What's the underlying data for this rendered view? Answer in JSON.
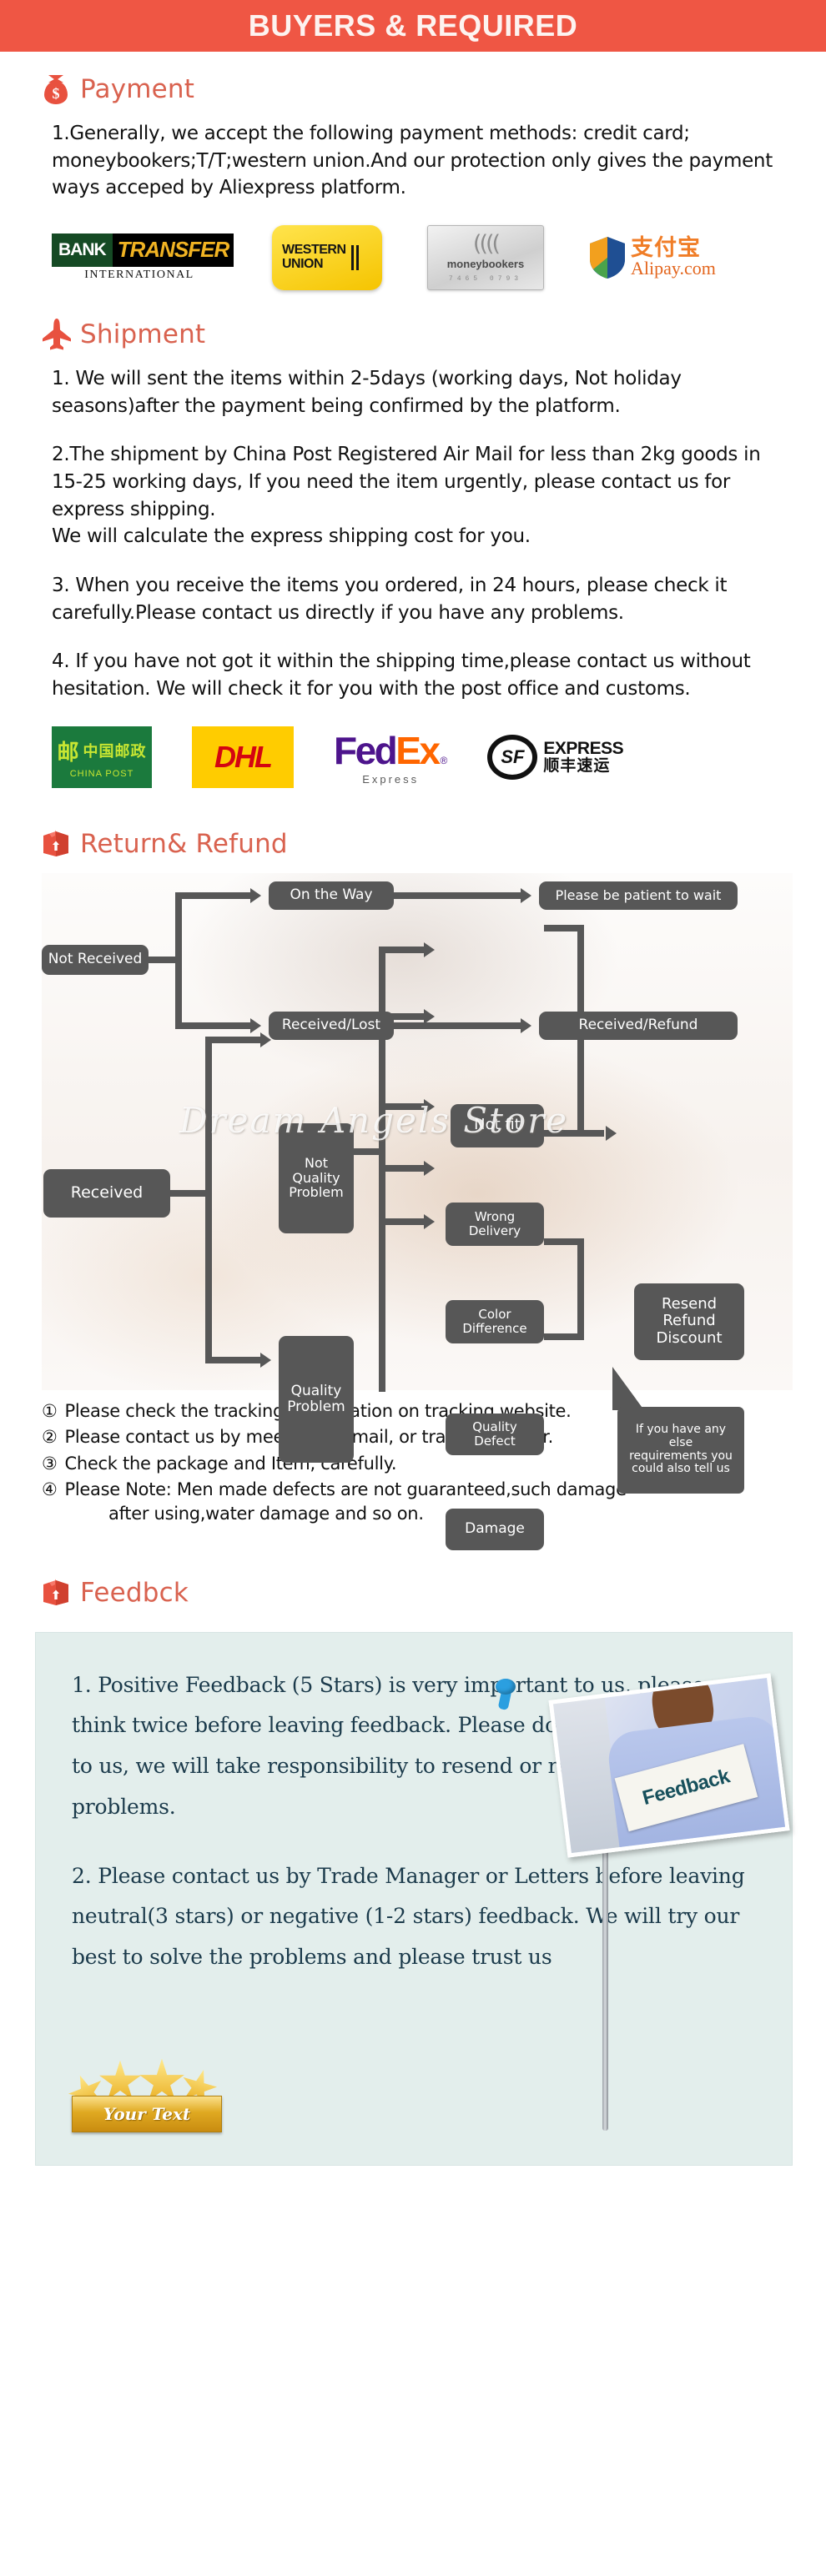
{
  "banner": {
    "title": "BUYERS & REQUIRED"
  },
  "payment": {
    "heading": "Payment",
    "icon": "money-bag-icon",
    "paragraph": "1.Generally, we accept the following payment methods: credit card; moneybookers;T/T;western union.And our protection only gives the payment ways acceped by Aliexpress platform.",
    "logos": [
      {
        "name": "bank-transfer",
        "word1": "BANK",
        "word2": "TRANSFER",
        "sub": "INTERNATIONAL"
      },
      {
        "name": "western-union",
        "line1": "WESTERN",
        "line2": "UNION"
      },
      {
        "name": "moneybookers",
        "label": "moneybookers",
        "arcs": "((((",
        "digits": "7465 0793"
      },
      {
        "name": "alipay",
        "cn": "支付宝",
        "com": "Alipay.com"
      }
    ]
  },
  "shipment": {
    "heading": "Shipment",
    "icon": "airplane-icon",
    "paragraphs": [
      "1. We will sent the items within 2-5days (working days, Not holiday seasons)after the payment being confirmed by the platform.",
      "2.The shipment by China Post Registered Air Mail for less than  2kg goods in 15-25 working days, If  you need the item urgently, please contact us for express shipping.\nWe will calculate the express shipping cost for you.",
      "3. When you receive the items you ordered, in 24 hours, please check  it carefully.Please contact us directly if you have any problems.",
      "4. If you have not got it within the shipping time,please contact us without hesitation. We will check it for you with the post office and customs."
    ],
    "logos": [
      {
        "name": "china-post",
        "cn": "中国邮政",
        "en": "CHINA POST",
        "mark": "邮"
      },
      {
        "name": "dhl",
        "text": "DHL"
      },
      {
        "name": "fedex",
        "fed": "Fed",
        "ex": "Ex",
        "reg": "®",
        "sub": "Express"
      },
      {
        "name": "sf-express",
        "mark": "SF",
        "en": "EXPRESS",
        "cn": "顺丰速运"
      }
    ]
  },
  "returns": {
    "heading": "Return& Refund",
    "icon": "return-box-icon",
    "watermark": "Dream   Angels Store",
    "flow": {
      "not_received": "Not Received",
      "on_the_way": "On the Way",
      "please_wait": "Please be patient to wait",
      "received_lost": "Received/Lost",
      "received_refund": "Received/Refund",
      "received": "Received",
      "not_quality_problem": "Not\nQuality\nProblem",
      "quality_problem": "Quality\nProblem",
      "not_fit": "Not fit",
      "wrong_delivery": "Wrong Delivery",
      "color_difference": "Color Difference",
      "quality_defect": "Quality Defect",
      "damage": "Damage",
      "resend_refund_discount": "Resend\nRefund\nDiscount",
      "callout": "If you have any else\nrequirements you\ncould also tell us"
    },
    "notes": [
      {
        "num": "①",
        "text": "Please check the tracking in formation on tracking website."
      },
      {
        "num": "②",
        "text": "Please contact us by meesage, e-mail, or trade manager."
      },
      {
        "num": "③",
        "text": "Check the package and Item, carefully."
      },
      {
        "num": "④",
        "text": "Please Note: Men made defects  are not guaranteed,such damage"
      }
    ],
    "note_continuation": "after using,water damage and so on."
  },
  "feedback": {
    "heading": "Feedbck",
    "icon": "feedback-box-icon",
    "photo_sign_text": "Feedback",
    "paragraphs": [
      "1. Positive Feedback (5 Stars) is very important to us, please think twice before leaving feedback. Please do not open dispute to us,   we will take responsibility to resend or refund for any problems.",
      "2. Please contact us by Trade Manager or Letters before leaving neutral(3 stars) or negative (1-2 stars) feedback. We will try our best to solve the problems and please trust us"
    ],
    "badge_text": "Your Text"
  },
  "colors": {
    "banner_bg": "#ef5644",
    "heading_text": "#d9624f",
    "node_bg": "#575757",
    "feedback_bg": "#e3eeec",
    "feedback_text": "#1b3a4b"
  }
}
